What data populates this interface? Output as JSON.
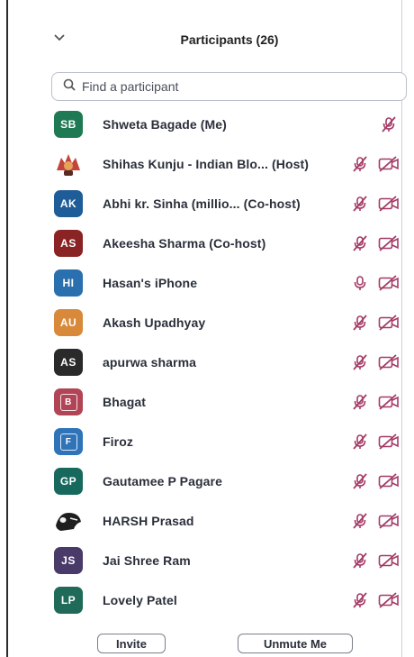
{
  "panel": {
    "title": "Participants (26)"
  },
  "search": {
    "placeholder": "Find a participant"
  },
  "colors": {
    "muted_icon": "#a43a66",
    "av_sb": "#1f7a54",
    "av_ak": "#1f5d99",
    "av_as": "#8a2424",
    "av_hi": "#2a6fae",
    "av_au": "#d88a3a",
    "av_as2": "#2a2a2a",
    "av_b": "#b14555",
    "av_f": "#2f73b8",
    "av_gp": "#17695e",
    "av_js": "#4a3a6a",
    "av_lp": "#1f6a58"
  },
  "participants": [
    {
      "initials": "SB",
      "name": "Shweta Bagade (Me)",
      "mic": "muted",
      "video": "none"
    },
    {
      "initials": "",
      "name": "Shihas Kunju - Indian Blo... (Host)",
      "mic": "muted",
      "video": "off"
    },
    {
      "initials": "AK",
      "name": "Abhi kr. Sinha (millio...  (Co-host)",
      "mic": "muted",
      "video": "off"
    },
    {
      "initials": "AS",
      "name": "Akeesha Sharma (Co-host)",
      "mic": "muted",
      "video": "off"
    },
    {
      "initials": "HI",
      "name": "Hasan's iPhone",
      "mic": "on",
      "video": "off"
    },
    {
      "initials": "AU",
      "name": "Akash Upadhyay",
      "mic": "muted",
      "video": "off"
    },
    {
      "initials": "AS",
      "name": "apurwa sharma",
      "mic": "muted",
      "video": "off"
    },
    {
      "initials": "B",
      "name": "Bhagat",
      "mic": "muted",
      "video": "off"
    },
    {
      "initials": "F",
      "name": "Firoz",
      "mic": "muted",
      "video": "off"
    },
    {
      "initials": "GP",
      "name": "Gautamee P Pagare",
      "mic": "muted",
      "video": "off"
    },
    {
      "initials": "",
      "name": "HARSH Prasad",
      "mic": "muted",
      "video": "off"
    },
    {
      "initials": "JS",
      "name": "Jai Shree Ram",
      "mic": "muted",
      "video": "off"
    },
    {
      "initials": "LP",
      "name": "Lovely Patel",
      "mic": "muted",
      "video": "off"
    }
  ],
  "footer": {
    "invite_label": "Invite",
    "unmute_label": "Unmute Me"
  }
}
